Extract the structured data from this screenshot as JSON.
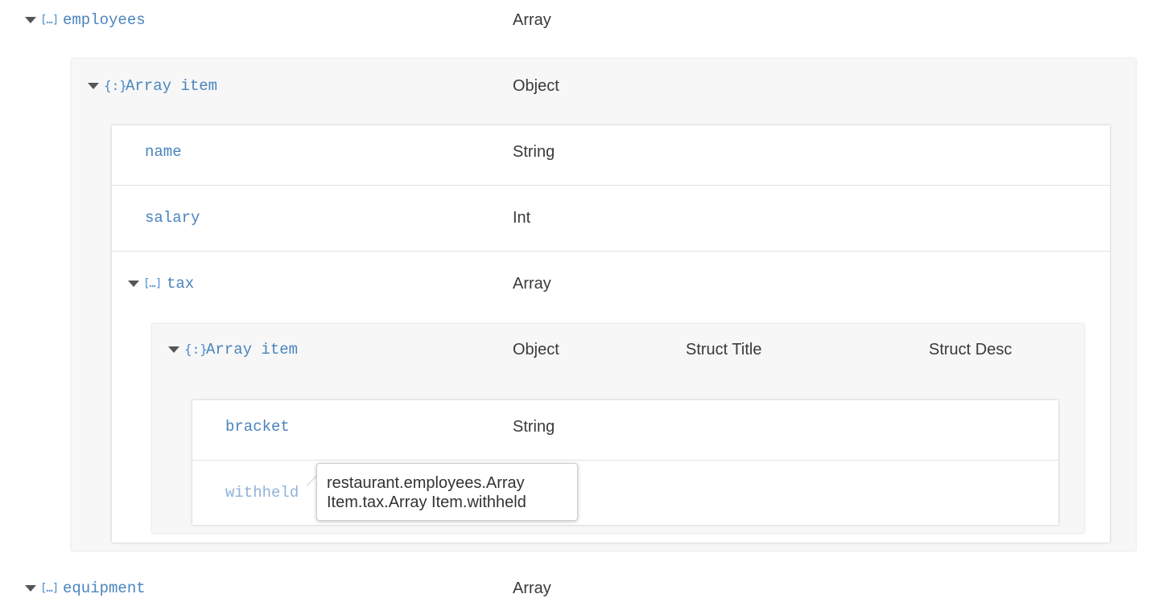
{
  "rows": {
    "employees": {
      "name": "employees",
      "type": "Array",
      "icon": "array-bracket-icon"
    },
    "array_item_1": {
      "name": "Array item",
      "type": "Object",
      "icon": "object-brace-icon"
    },
    "name": {
      "name": "name",
      "type": "String"
    },
    "salary": {
      "name": "salary",
      "type": "Int"
    },
    "tax": {
      "name": "tax",
      "type": "Array",
      "icon": "array-bracket-icon"
    },
    "array_item_2": {
      "name": "Array item",
      "type": "Object",
      "title": "Struct Title",
      "desc": "Struct Desc",
      "icon": "object-brace-icon"
    },
    "bracket": {
      "name": "bracket",
      "type": "String"
    },
    "withheld": {
      "name": "withheld"
    },
    "equipment": {
      "name": "equipment",
      "type": "Array",
      "icon": "array-bracket-icon"
    }
  },
  "icons": {
    "array_glyph": "[…]",
    "object_glyph": "{:}"
  },
  "tooltip": {
    "text": "restaurant.employees.Array Item.tax.Array Item.withheld"
  },
  "colors": {
    "link": "#4a84bd",
    "text": "#3a3a3a",
    "panel": "#f7f7f7"
  }
}
